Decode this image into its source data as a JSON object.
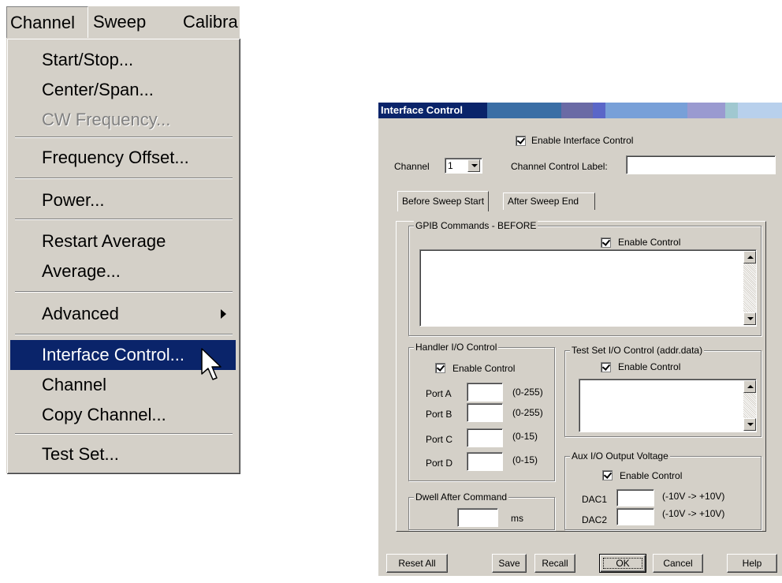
{
  "menubar": {
    "items": [
      {
        "label": "Channel"
      },
      {
        "label": "Sweep"
      },
      {
        "label": "Calibra"
      }
    ]
  },
  "channel_menu": {
    "items": [
      {
        "label": "Start/Stop...",
        "enabled": true
      },
      {
        "label": "Center/Span...",
        "enabled": true
      },
      {
        "label": "CW Frequency...",
        "enabled": false
      },
      {
        "label": "Frequency Offset...",
        "enabled": true
      },
      {
        "label": "Power...",
        "enabled": true
      },
      {
        "label": "Restart Average",
        "enabled": true
      },
      {
        "label": "Average...",
        "enabled": true
      },
      {
        "label": "Advanced",
        "enabled": true,
        "submenu": true
      },
      {
        "label": "Interface Control...",
        "enabled": true,
        "selected": true
      },
      {
        "label": "Channel",
        "enabled": true
      },
      {
        "label": "Copy Channel...",
        "enabled": true
      },
      {
        "label": "Test Set...",
        "enabled": true
      }
    ]
  },
  "dialog": {
    "title": "Interface Control",
    "enable_interface_control": "Enable Interface Control",
    "channel_label": "Channel",
    "channel_value": "1",
    "channel_control_label": "Channel Control Label:",
    "channel_control_value": "",
    "tabs": [
      "Before Sweep Start",
      "After Sweep End"
    ],
    "active_tab": "Before Sweep Start",
    "gpib": {
      "title": "GPIB Commands - BEFORE",
      "enable": "Enable Control",
      "text": ""
    },
    "handler": {
      "title": "Handler I/O Control",
      "enable": "Enable Control",
      "ports": [
        {
          "label": "Port A",
          "value": "",
          "range": "(0-255)"
        },
        {
          "label": "Port B",
          "value": "",
          "range": "(0-255)"
        },
        {
          "label": "Port C",
          "value": "",
          "range": "(0-15)"
        },
        {
          "label": "Port D",
          "value": "",
          "range": "(0-15)"
        }
      ]
    },
    "testset": {
      "title": "Test Set I/O Control (addr.data)",
      "enable": "Enable Control"
    },
    "aux": {
      "title": "Aux I/O Output Voltage",
      "enable": "Enable Control",
      "dacs": [
        {
          "label": "DAC1",
          "value": "",
          "range": "(-10V -> +10V)"
        },
        {
          "label": "DAC2",
          "value": "",
          "range": "(-10V -> +10V)"
        }
      ]
    },
    "dwell": {
      "title": "Dwell After Command",
      "value": "",
      "unit": "ms"
    },
    "buttons": {
      "reset_all": "Reset All",
      "save": "Save",
      "recall": "Recall",
      "ok": "OK",
      "cancel": "Cancel",
      "help": "Help"
    }
  }
}
